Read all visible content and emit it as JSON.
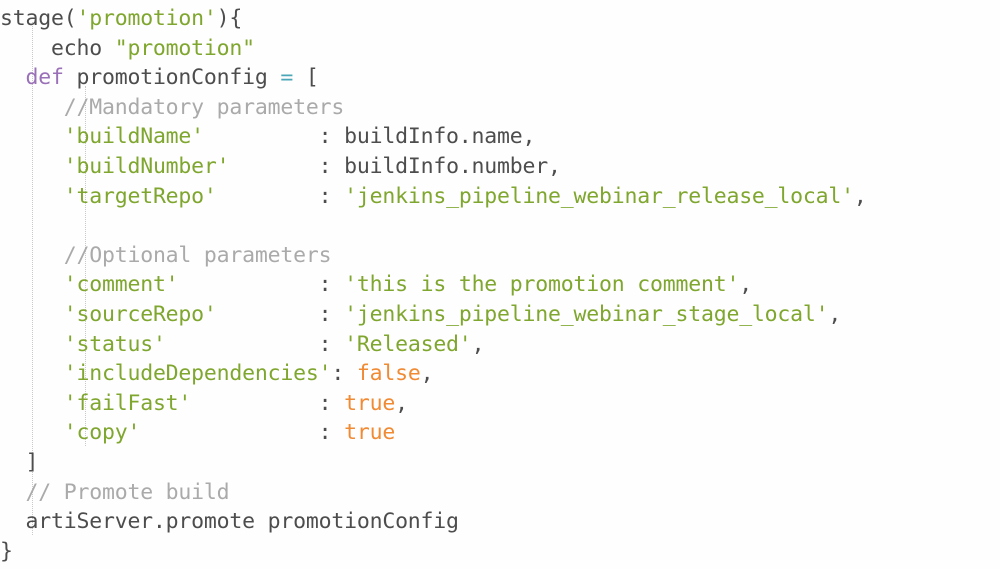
{
  "editor": {
    "language": "Groovy",
    "background_color": "#fefefe",
    "indent_guide_color": "#c9c9c9",
    "palette": {
      "plain": "#4d4d4d",
      "string": "#7fa62e",
      "keyword": "#9a70b8",
      "operator": "#4ba6b8",
      "comment": "#aaaaaa",
      "boolean": "#f08a33"
    }
  },
  "code": {
    "lines": [
      {
        "indent": 0,
        "tokens": [
          {
            "t": "plain",
            "v": "stage("
          },
          {
            "t": "string",
            "v": "'promotion'"
          },
          {
            "t": "plain",
            "v": "){"
          }
        ]
      },
      {
        "indent": 0,
        "tokens": [
          {
            "t": "plain",
            "v": "    echo "
          },
          {
            "t": "string",
            "v": "\"promotion\""
          }
        ]
      },
      {
        "indent": 0,
        "tokens": [
          {
            "t": "plain",
            "v": "  "
          },
          {
            "t": "keyword",
            "v": "def"
          },
          {
            "t": "plain",
            "v": " promotionConfig "
          },
          {
            "t": "operator",
            "v": "="
          },
          {
            "t": "plain",
            "v": " ["
          }
        ]
      },
      {
        "indent": 0,
        "tokens": [
          {
            "t": "plain",
            "v": "     "
          },
          {
            "t": "comment",
            "v": "//Mandatory parameters"
          }
        ]
      },
      {
        "indent": 0,
        "tokens": [
          {
            "t": "plain",
            "v": "     "
          },
          {
            "t": "string",
            "v": "'buildName'"
          },
          {
            "t": "plain",
            "v": "         : buildInfo.name,"
          }
        ]
      },
      {
        "indent": 0,
        "tokens": [
          {
            "t": "plain",
            "v": "     "
          },
          {
            "t": "string",
            "v": "'buildNumber'"
          },
          {
            "t": "plain",
            "v": "       : buildInfo.number,"
          }
        ]
      },
      {
        "indent": 0,
        "tokens": [
          {
            "t": "plain",
            "v": "     "
          },
          {
            "t": "string",
            "v": "'targetRepo'"
          },
          {
            "t": "plain",
            "v": "        : "
          },
          {
            "t": "string",
            "v": "'jenkins_pipeline_webinar_release_local'"
          },
          {
            "t": "plain",
            "v": ","
          }
        ]
      },
      {
        "indent": 0,
        "tokens": []
      },
      {
        "indent": 0,
        "tokens": [
          {
            "t": "plain",
            "v": "     "
          },
          {
            "t": "comment",
            "v": "//Optional parameters"
          }
        ]
      },
      {
        "indent": 0,
        "tokens": [
          {
            "t": "plain",
            "v": "     "
          },
          {
            "t": "string",
            "v": "'comment'"
          },
          {
            "t": "plain",
            "v": "           : "
          },
          {
            "t": "string",
            "v": "'this is the promotion comment'"
          },
          {
            "t": "plain",
            "v": ","
          }
        ]
      },
      {
        "indent": 0,
        "tokens": [
          {
            "t": "plain",
            "v": "     "
          },
          {
            "t": "string",
            "v": "'sourceRepo'"
          },
          {
            "t": "plain",
            "v": "        : "
          },
          {
            "t": "string",
            "v": "'jenkins_pipeline_webinar_stage_local'"
          },
          {
            "t": "plain",
            "v": ","
          }
        ]
      },
      {
        "indent": 0,
        "tokens": [
          {
            "t": "plain",
            "v": "     "
          },
          {
            "t": "string",
            "v": "'status'"
          },
          {
            "t": "plain",
            "v": "            : "
          },
          {
            "t": "string",
            "v": "'Released'"
          },
          {
            "t": "plain",
            "v": ","
          }
        ]
      },
      {
        "indent": 0,
        "tokens": [
          {
            "t": "plain",
            "v": "     "
          },
          {
            "t": "string",
            "v": "'includeDependencies'"
          },
          {
            "t": "plain",
            "v": ": "
          },
          {
            "t": "boolean",
            "v": "false"
          },
          {
            "t": "plain",
            "v": ","
          }
        ]
      },
      {
        "indent": 0,
        "tokens": [
          {
            "t": "plain",
            "v": "     "
          },
          {
            "t": "string",
            "v": "'failFast'"
          },
          {
            "t": "plain",
            "v": "          : "
          },
          {
            "t": "boolean",
            "v": "true"
          },
          {
            "t": "plain",
            "v": ","
          }
        ]
      },
      {
        "indent": 0,
        "tokens": [
          {
            "t": "plain",
            "v": "     "
          },
          {
            "t": "string",
            "v": "'copy'"
          },
          {
            "t": "plain",
            "v": "              : "
          },
          {
            "t": "boolean",
            "v": "true"
          }
        ]
      },
      {
        "indent": 0,
        "tokens": [
          {
            "t": "plain",
            "v": "  ]"
          }
        ]
      },
      {
        "indent": 0,
        "tokens": [
          {
            "t": "plain",
            "v": "  "
          },
          {
            "t": "comment",
            "v": "// Promote build"
          }
        ]
      },
      {
        "indent": 0,
        "tokens": [
          {
            "t": "plain",
            "v": "  artiServer.promote promotionConfig"
          }
        ]
      },
      {
        "indent": 0,
        "tokens": [
          {
            "t": "plain",
            "v": "}"
          }
        ]
      }
    ]
  }
}
